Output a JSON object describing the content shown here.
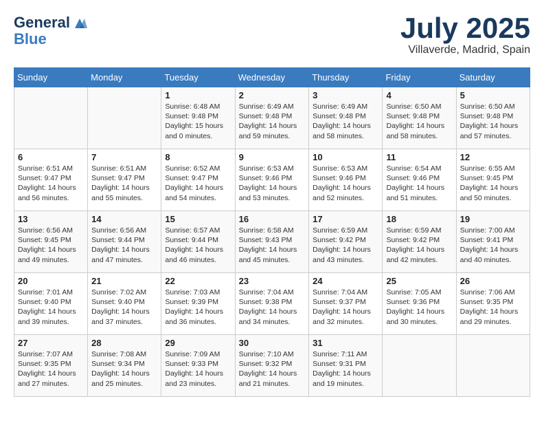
{
  "header": {
    "logo_line1": "General",
    "logo_line2": "Blue",
    "month": "July 2025",
    "location": "Villaverde, Madrid, Spain"
  },
  "weekdays": [
    "Sunday",
    "Monday",
    "Tuesday",
    "Wednesday",
    "Thursday",
    "Friday",
    "Saturday"
  ],
  "weeks": [
    [
      {
        "day": "",
        "content": ""
      },
      {
        "day": "",
        "content": ""
      },
      {
        "day": "1",
        "content": "Sunrise: 6:48 AM\nSunset: 9:48 PM\nDaylight: 15 hours\nand 0 minutes."
      },
      {
        "day": "2",
        "content": "Sunrise: 6:49 AM\nSunset: 9:48 PM\nDaylight: 14 hours\nand 59 minutes."
      },
      {
        "day": "3",
        "content": "Sunrise: 6:49 AM\nSunset: 9:48 PM\nDaylight: 14 hours\nand 58 minutes."
      },
      {
        "day": "4",
        "content": "Sunrise: 6:50 AM\nSunset: 9:48 PM\nDaylight: 14 hours\nand 58 minutes."
      },
      {
        "day": "5",
        "content": "Sunrise: 6:50 AM\nSunset: 9:48 PM\nDaylight: 14 hours\nand 57 minutes."
      }
    ],
    [
      {
        "day": "6",
        "content": "Sunrise: 6:51 AM\nSunset: 9:47 PM\nDaylight: 14 hours\nand 56 minutes."
      },
      {
        "day": "7",
        "content": "Sunrise: 6:51 AM\nSunset: 9:47 PM\nDaylight: 14 hours\nand 55 minutes."
      },
      {
        "day": "8",
        "content": "Sunrise: 6:52 AM\nSunset: 9:47 PM\nDaylight: 14 hours\nand 54 minutes."
      },
      {
        "day": "9",
        "content": "Sunrise: 6:53 AM\nSunset: 9:46 PM\nDaylight: 14 hours\nand 53 minutes."
      },
      {
        "day": "10",
        "content": "Sunrise: 6:53 AM\nSunset: 9:46 PM\nDaylight: 14 hours\nand 52 minutes."
      },
      {
        "day": "11",
        "content": "Sunrise: 6:54 AM\nSunset: 9:46 PM\nDaylight: 14 hours\nand 51 minutes."
      },
      {
        "day": "12",
        "content": "Sunrise: 6:55 AM\nSunset: 9:45 PM\nDaylight: 14 hours\nand 50 minutes."
      }
    ],
    [
      {
        "day": "13",
        "content": "Sunrise: 6:56 AM\nSunset: 9:45 PM\nDaylight: 14 hours\nand 49 minutes."
      },
      {
        "day": "14",
        "content": "Sunrise: 6:56 AM\nSunset: 9:44 PM\nDaylight: 14 hours\nand 47 minutes."
      },
      {
        "day": "15",
        "content": "Sunrise: 6:57 AM\nSunset: 9:44 PM\nDaylight: 14 hours\nand 46 minutes."
      },
      {
        "day": "16",
        "content": "Sunrise: 6:58 AM\nSunset: 9:43 PM\nDaylight: 14 hours\nand 45 minutes."
      },
      {
        "day": "17",
        "content": "Sunrise: 6:59 AM\nSunset: 9:42 PM\nDaylight: 14 hours\nand 43 minutes."
      },
      {
        "day": "18",
        "content": "Sunrise: 6:59 AM\nSunset: 9:42 PM\nDaylight: 14 hours\nand 42 minutes."
      },
      {
        "day": "19",
        "content": "Sunrise: 7:00 AM\nSunset: 9:41 PM\nDaylight: 14 hours\nand 40 minutes."
      }
    ],
    [
      {
        "day": "20",
        "content": "Sunrise: 7:01 AM\nSunset: 9:40 PM\nDaylight: 14 hours\nand 39 minutes."
      },
      {
        "day": "21",
        "content": "Sunrise: 7:02 AM\nSunset: 9:40 PM\nDaylight: 14 hours\nand 37 minutes."
      },
      {
        "day": "22",
        "content": "Sunrise: 7:03 AM\nSunset: 9:39 PM\nDaylight: 14 hours\nand 36 minutes."
      },
      {
        "day": "23",
        "content": "Sunrise: 7:04 AM\nSunset: 9:38 PM\nDaylight: 14 hours\nand 34 minutes."
      },
      {
        "day": "24",
        "content": "Sunrise: 7:04 AM\nSunset: 9:37 PM\nDaylight: 14 hours\nand 32 minutes."
      },
      {
        "day": "25",
        "content": "Sunrise: 7:05 AM\nSunset: 9:36 PM\nDaylight: 14 hours\nand 30 minutes."
      },
      {
        "day": "26",
        "content": "Sunrise: 7:06 AM\nSunset: 9:35 PM\nDaylight: 14 hours\nand 29 minutes."
      }
    ],
    [
      {
        "day": "27",
        "content": "Sunrise: 7:07 AM\nSunset: 9:35 PM\nDaylight: 14 hours\nand 27 minutes."
      },
      {
        "day": "28",
        "content": "Sunrise: 7:08 AM\nSunset: 9:34 PM\nDaylight: 14 hours\nand 25 minutes."
      },
      {
        "day": "29",
        "content": "Sunrise: 7:09 AM\nSunset: 9:33 PM\nDaylight: 14 hours\nand 23 minutes."
      },
      {
        "day": "30",
        "content": "Sunrise: 7:10 AM\nSunset: 9:32 PM\nDaylight: 14 hours\nand 21 minutes."
      },
      {
        "day": "31",
        "content": "Sunrise: 7:11 AM\nSunset: 9:31 PM\nDaylight: 14 hours\nand 19 minutes."
      },
      {
        "day": "",
        "content": ""
      },
      {
        "day": "",
        "content": ""
      }
    ]
  ]
}
